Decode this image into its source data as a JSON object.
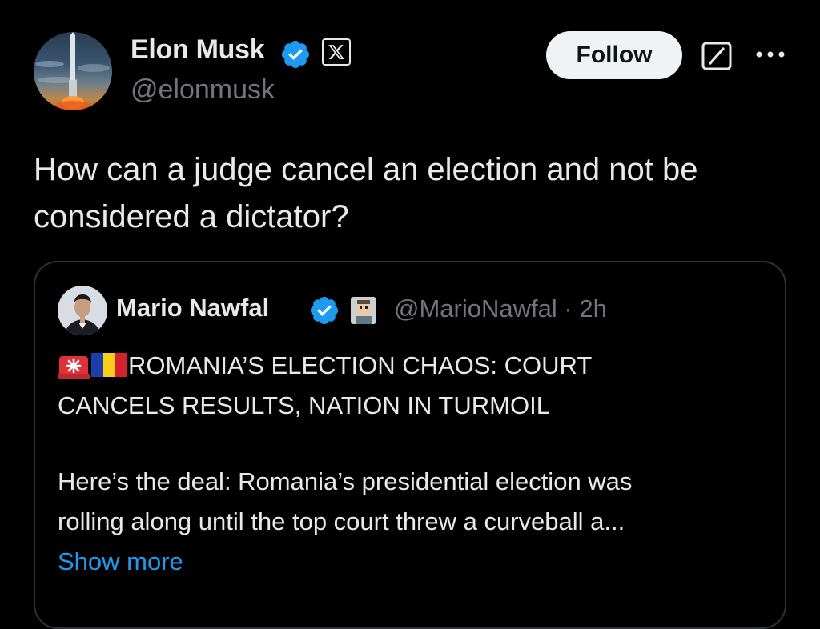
{
  "post": {
    "author": {
      "name": "Elon Musk",
      "handle": "@elonmusk",
      "verified_color": "#1d9bf0"
    },
    "follow_label": "Follow",
    "text_line1": "How can a judge cancel an election and not be",
    "text_line2": "considered a dictator?"
  },
  "quote": {
    "author": {
      "name": "Mario Nawfal",
      "handle": "@MarioNawfal",
      "separator": "·",
      "time": "2h"
    },
    "headline_line1": "ROMANIA’S ELECTION CHAOS: COURT",
    "headline_line2": "CANCELS RESULTS, NATION IN TURMOIL",
    "emojis": [
      "rotating-light-emoji",
      "romania-flag-emoji"
    ],
    "body_line1": "Here’s the deal: Romania’s presidential election was",
    "body_line2": "rolling along until the top court threw a curveball a...",
    "show_more_label": "Show more"
  },
  "colors": {
    "background": "#000000",
    "text_primary": "#e7e9ea",
    "text_secondary": "#71767b",
    "link": "#1d9bf0",
    "border": "#2f3336",
    "follow_bg": "#eff3f4"
  },
  "icons": [
    "verified-badge-icon",
    "x-logo-icon",
    "grok-icon",
    "more-options-icon"
  ]
}
